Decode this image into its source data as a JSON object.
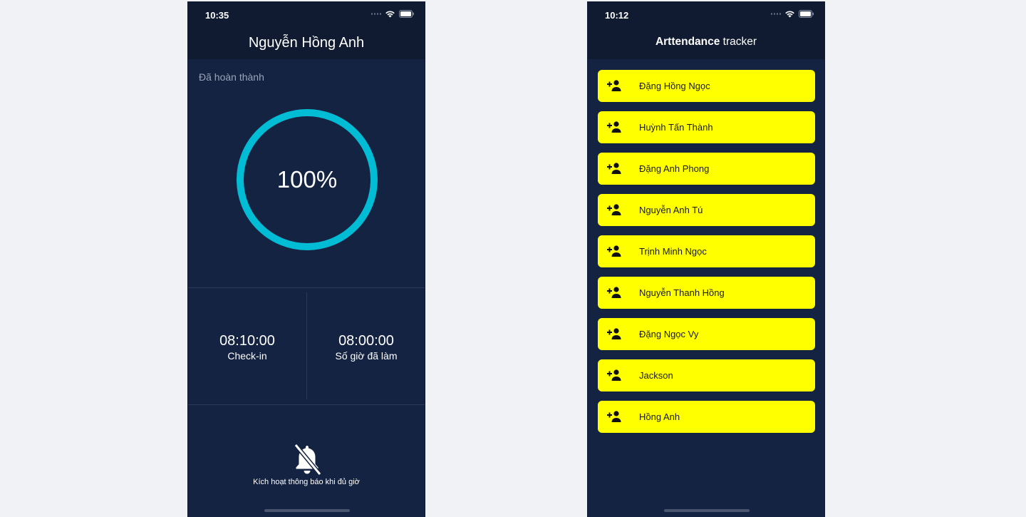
{
  "left_screen": {
    "status_time": "10:35",
    "title": "Nguyễn Hồng Anh",
    "section_label": "Đã hoàn thành",
    "progress": {
      "value": 1.0,
      "text": "100%"
    },
    "checkin": {
      "value": "08:10:00",
      "label": "Check-in"
    },
    "hours_worked": {
      "value": "08:00:00",
      "label": "Số giờ đã làm"
    },
    "notification_label": "Kích hoạt thông báo khi đủ giờ",
    "ring_color": "#00bcd4"
  },
  "right_screen": {
    "status_time": "10:12",
    "title_bold": "Arttendance",
    "title_rest": " tracker",
    "item_color": "#ffff00",
    "members": [
      {
        "name": "Đặng Hồng Ngọc"
      },
      {
        "name": "Huỳnh Tấn Thành"
      },
      {
        "name": "Đặng Anh Phong"
      },
      {
        "name": "Nguyễn Anh Tú"
      },
      {
        "name": "Trịnh Minh Ngọc"
      },
      {
        "name": "Nguyễn Thanh Hồng"
      },
      {
        "name": "Đặng Ngọc Vy"
      },
      {
        "name": "Jackson"
      },
      {
        "name": "Hồng Anh"
      }
    ],
    "member_icon": "person-add-icon"
  }
}
